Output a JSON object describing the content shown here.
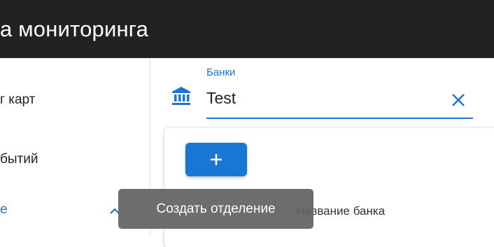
{
  "header": {
    "title": "а мониторинга"
  },
  "sidebar": {
    "items": [
      {
        "label": "г карт"
      },
      {
        "label": "бытий"
      },
      {
        "label": "е"
      }
    ]
  },
  "bank_field": {
    "label": "Банки",
    "value": "Test"
  },
  "table": {
    "column_header": "Название банка"
  },
  "tooltip": {
    "text": "Создать отделение"
  },
  "colors": {
    "accent": "#1976d2",
    "topbar": "#222222",
    "tooltip_bg": "#616161"
  },
  "icons": {
    "field_icon": "bank-icon",
    "clear": "close-icon",
    "add": "plus-icon",
    "nav_expand": "chevron-up-icon"
  }
}
